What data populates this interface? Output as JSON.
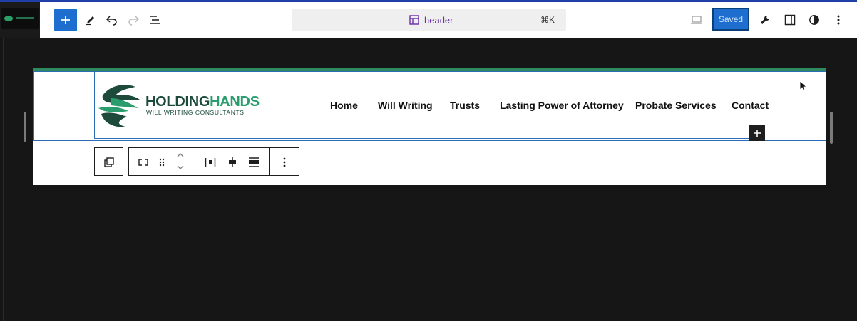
{
  "toolbar": {
    "document_title": "header",
    "shortcut": "⌘K",
    "saved_label": "Saved",
    "accent_color": "#1e6ecf"
  },
  "site_header": {
    "logo_word_1": "HOLDING",
    "logo_word_2": "HANDS",
    "logo_tagline": "WILL WRITING CONSULTANTS",
    "brand_green": "#2a9c6d",
    "brand_dark": "#1d4a3b",
    "nav": [
      "Home",
      "Will Writing",
      "Trusts",
      "Lasting Power of Attorney",
      "Probate Services",
      "Contact"
    ]
  },
  "icons": {
    "toolbar": [
      "plus-icon",
      "pen-icon",
      "undo-icon",
      "redo-icon",
      "list-view-icon",
      "template-icon",
      "desktop-preview-icon",
      "wrench-icon",
      "sidebar-icon",
      "contrast-icon",
      "more-vertical-icon"
    ],
    "block_toolbar": [
      "duplicate-icon",
      "group-icon",
      "drag-icon",
      "move-up-icon",
      "move-down-icon",
      "justify-space-between-icon",
      "justify-center-icon",
      "justify-stretch-icon",
      "more-vertical-icon"
    ]
  }
}
